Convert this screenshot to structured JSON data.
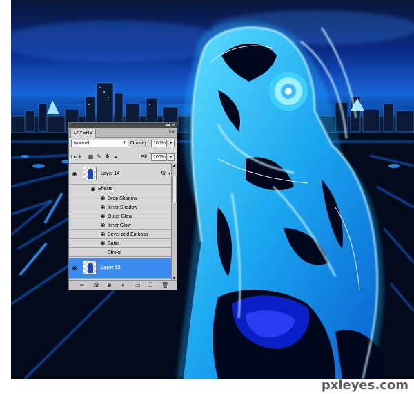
{
  "panel": {
    "tab": "LAYERS",
    "blend_mode": "Normal",
    "opacity_label": "Opacity:",
    "opacity_value": "100%",
    "lock_label": "Lock:",
    "fill_label": "Fill:",
    "fill_value": "100%",
    "layers": [
      {
        "name": "Layer 14",
        "fx": "fx",
        "selected": false
      },
      {
        "name": "Layer 12",
        "selected": true
      }
    ],
    "effects_label": "Effects",
    "effects": [
      "Drop Shadow",
      "Inner Shadow",
      "Outer Glow",
      "Inner Glow",
      "Bevel and Emboss",
      "Satin",
      "Stroke"
    ]
  },
  "icons": {
    "eye": "eye-icon",
    "collapse": "double-chevron-icon",
    "close": "close-icon",
    "menu": "panel-menu-icon",
    "link": "link-layers-icon",
    "fx": "add-layer-style-icon",
    "mask": "add-mask-icon",
    "adjust": "adjustment-layer-icon",
    "group": "new-group-icon",
    "new": "new-layer-icon",
    "trash": "trash-icon"
  },
  "watermark": "pxleyes.com",
  "colors": {
    "selection": "#3d8af0",
    "glow": "#4fd8ff",
    "panel_bg": "#d6d6d6"
  }
}
